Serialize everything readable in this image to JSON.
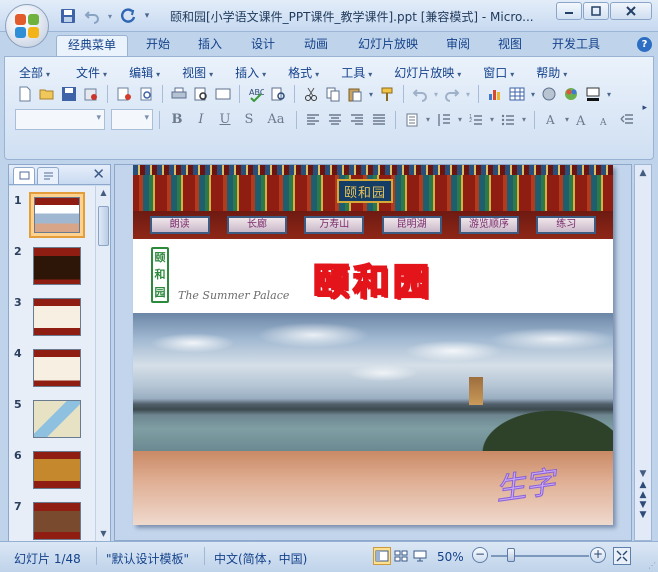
{
  "window": {
    "title": "颐和园[小学语文课件_PPT课件_教学课件].ppt [兼容模式] - Micro...",
    "controls": [
      "minimize",
      "maximize",
      "close"
    ]
  },
  "ribbon_tabs": [
    {
      "label": "经典菜单",
      "active": true
    },
    {
      "label": "开始",
      "active": false
    },
    {
      "label": "插入",
      "active": false
    },
    {
      "label": "设计",
      "active": false
    },
    {
      "label": "动画",
      "active": false
    },
    {
      "label": "幻灯片放映",
      "active": false
    },
    {
      "label": "审阅",
      "active": false
    },
    {
      "label": "视图",
      "active": false
    },
    {
      "label": "开发工具",
      "active": false
    }
  ],
  "classic_menu": [
    "全部",
    "文件",
    "编辑",
    "视图",
    "插入",
    "格式",
    "工具",
    "幻灯片放映",
    "窗口",
    "帮助"
  ],
  "format_buttons": {
    "bold": "B",
    "italic": "I",
    "underline": "U",
    "strike": "S",
    "case": "Aa"
  },
  "slide_panel": {
    "slides": [
      "1",
      "2",
      "3",
      "4",
      "5",
      "6",
      "7"
    ],
    "selected_index": 0
  },
  "slide": {
    "plaque_text": "颐和园",
    "nav_buttons": [
      "朗读",
      "长廊",
      "万寿山",
      "昆明湖",
      "游览顺序",
      "练习"
    ],
    "seal_chars": [
      "颐",
      "和",
      "园"
    ],
    "subtitle": "The Summer Palace",
    "title": "颐和园",
    "corner_text": "生字"
  },
  "status": {
    "slide_info": "幻灯片 1/48",
    "theme": "\"默认设计模板\"",
    "language": "中文(简体，中国)",
    "zoom": "50%"
  },
  "colors": {
    "accent": "#15428b",
    "title_red": "#e4141b",
    "selected_thumb": "#ffd28f"
  }
}
